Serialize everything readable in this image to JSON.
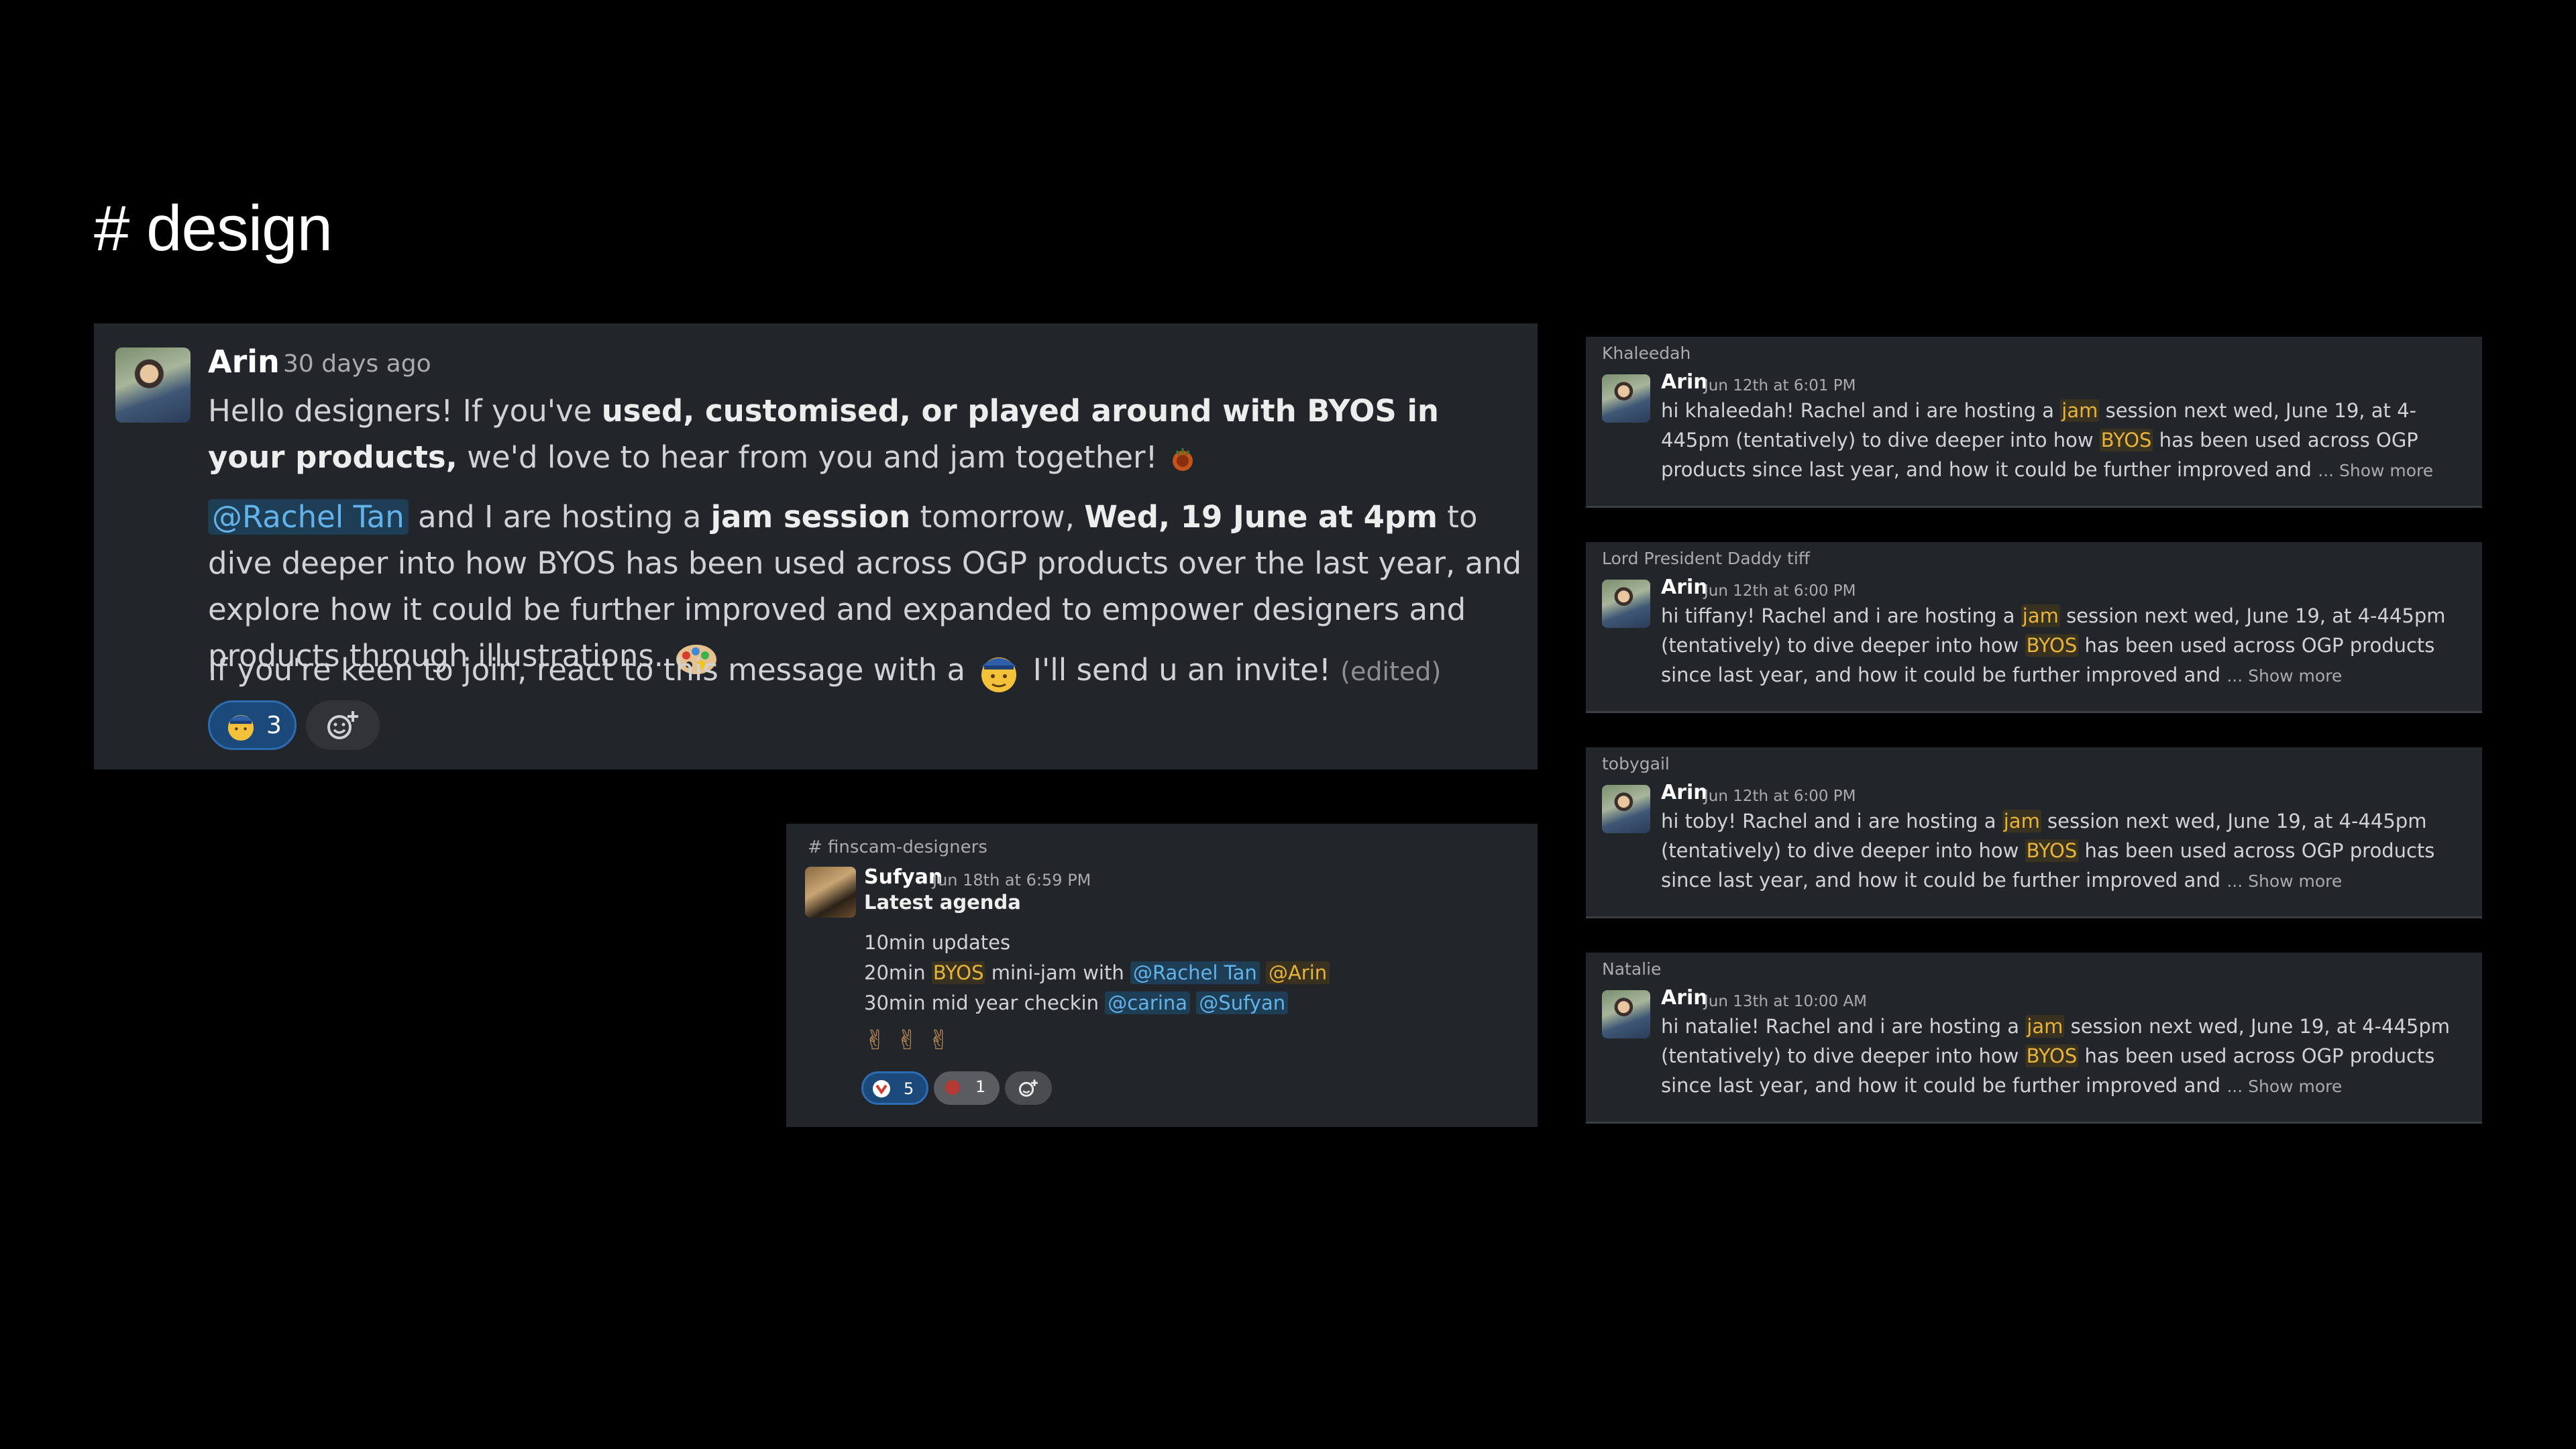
{
  "page": {
    "title": "# design"
  },
  "main_message": {
    "author": "Arin",
    "time": "30 days ago",
    "p1_a": "Hello designers! If you've ",
    "p1_b": "used, customised, or played around with BYOS in your products,",
    "p1_c": " we'd love to hear from you and jam together! ",
    "p2_mention": "@Rachel Tan",
    "p2_a": " and I are hosting a ",
    "p2_b": "jam session",
    "p2_c": " tomorrow, ",
    "p2_d": "Wed, 19 June at 4pm",
    "p2_e": " to dive deeper into how BYOS has been used across OGP products over the last year, and explore how it could be further improved and expanded to empower designers and products through illustrations. ",
    "p3_a": "If you're keen to join, react to this message with a ",
    "p3_b": " I'll send u an invite! ",
    "edited": "(edited)",
    "reaction_count": "3"
  },
  "channel_message": {
    "channel": "# finscam-designers",
    "author": "Sufyan",
    "time": "Jun 18th at 6:59 PM",
    "heading": "Latest agenda",
    "line1": "10min updates",
    "line2_a": "20min ",
    "line2_hl": "BYOS",
    "line2_b": " mini-jam with ",
    "line2_m1": "@Rachel Tan",
    "line2_m2": "@Arin",
    "line3_a": "30min mid year checkin ",
    "line3_m1": "@carina",
    "line3_m2": "@Sufyan",
    "emojis": "✌✌✌",
    "reaction1_count": "5",
    "reaction2_count": "1"
  },
  "dms": [
    {
      "recipient": "Khaleedah",
      "author": "Arin",
      "time": "Jun 12th at 6:01 PM",
      "greeting": "hi khaleedah! Rachel and i are hosting a "
    },
    {
      "recipient": "Lord President Daddy tiff",
      "author": "Arin",
      "time": "Jun 12th at 6:00 PM",
      "greeting": "hi tiffany! Rachel and i are hosting a "
    },
    {
      "recipient": "tobygail",
      "author": "Arin",
      "time": "Jun 12th at 6:00 PM",
      "greeting": "hi toby! Rachel and i are hosting a "
    },
    {
      "recipient": "Natalie",
      "author": "Arin",
      "time": "Jun 13th at 10:00 AM",
      "greeting": "hi natalie! Rachel and i are hosting a "
    }
  ],
  "dm_common": {
    "jam": "jam",
    "mid1": " session next wed, June 19, at 4-445pm (tentatively) to dive deeper into how ",
    "byos": "BYOS",
    "mid2": " has been used across OGP products since last year, and how it could be further improved and ",
    "show_more": "... Show more"
  },
  "colors": {
    "background": "#000000",
    "panel": "#222529",
    "mention": "#63b3ea",
    "highlight": "#e6b33b"
  }
}
